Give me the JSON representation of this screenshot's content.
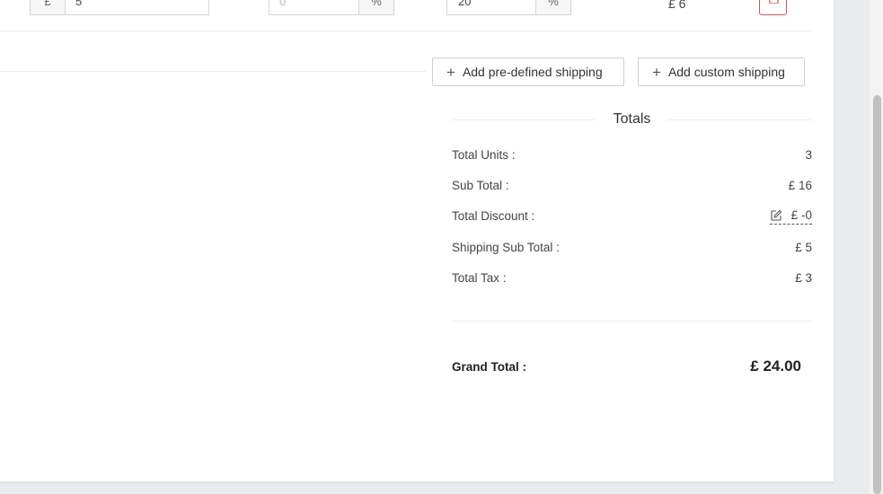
{
  "line_item": {
    "shipping_currency": "£",
    "shipping_value": "5",
    "discount_placeholder": "0",
    "discount_unit": "%",
    "tax_rate": "20",
    "tax_unit": "%",
    "line_total": "£ 6"
  },
  "actions": {
    "add_predefined_shipping": "Add pre-defined shipping",
    "add_custom_shipping": "Add custom shipping"
  },
  "totals": {
    "title": "Totals",
    "rows": [
      {
        "label": "Total Units :",
        "value": "3"
      },
      {
        "label": "Sub Total :",
        "value": "£ 16"
      },
      {
        "label": "Total Discount :",
        "value": "£ -0"
      },
      {
        "label": "Shipping Sub Total :",
        "value": "£ 5"
      },
      {
        "label": "Total Tax :",
        "value": "£ 3"
      }
    ],
    "grand_total_label": "Grand Total :",
    "grand_total_value": "£ 24.00"
  },
  "colors": {
    "delete_accent": "#d9534f",
    "page_background": "#e9ebee"
  },
  "icons": {
    "plus": "plus-icon",
    "trash": "trash-icon",
    "edit": "edit-icon"
  }
}
